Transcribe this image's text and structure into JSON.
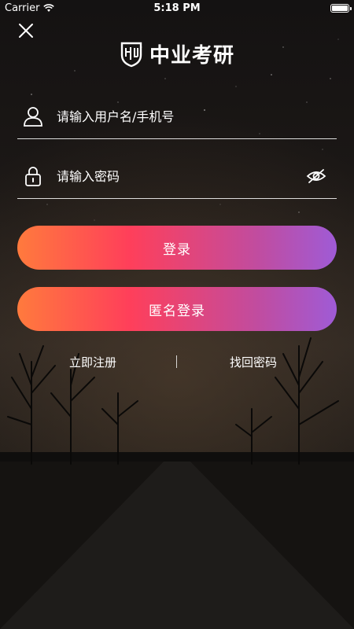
{
  "status_bar": {
    "carrier": "Carrier",
    "time": "5:18 PM"
  },
  "logo": {
    "text": "中业考研"
  },
  "username": {
    "placeholder": "请输入用户名/手机号",
    "value": ""
  },
  "password": {
    "placeholder": "请输入密码",
    "value": ""
  },
  "buttons": {
    "login": "登录",
    "anonymous_login": "匿名登录"
  },
  "links": {
    "register": "立即注册",
    "forgot_password": "找回密码"
  },
  "icons": {
    "close": "close-icon",
    "user": "user-icon",
    "lock": "lock-icon",
    "eye_hidden": "eye-off-icon",
    "wifi": "wifi-icon",
    "battery": "battery-icon"
  },
  "colors": {
    "gradient_start": "#ff7a3d",
    "gradient_mid": "#ff3f5a",
    "gradient_end": "#9f5bd6",
    "text": "#ffffff"
  }
}
